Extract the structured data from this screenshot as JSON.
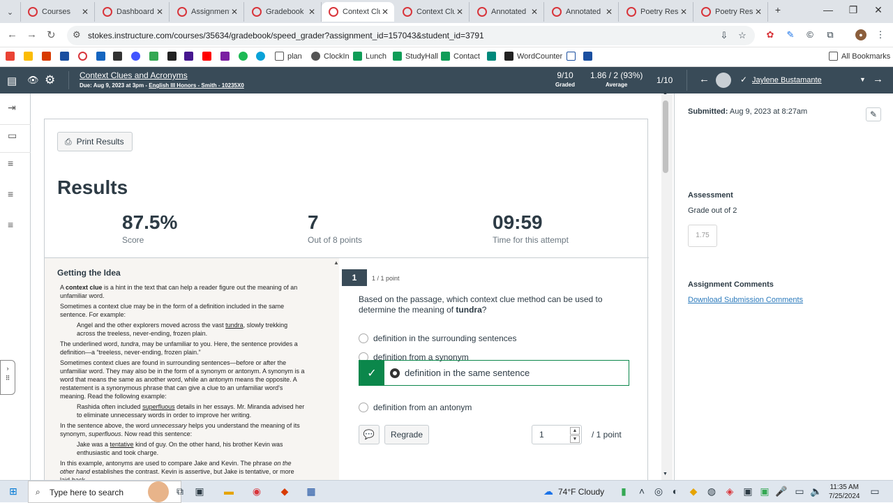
{
  "browser": {
    "tabs": [
      {
        "label": "Courses",
        "active": false
      },
      {
        "label": "Dashboard",
        "active": false
      },
      {
        "label": "Assignment",
        "active": false
      },
      {
        "label": "Gradebook",
        "active": false
      },
      {
        "label": "Context Clu",
        "active": true
      },
      {
        "label": "Context Clu",
        "active": false
      },
      {
        "label": "Annotated",
        "active": false
      },
      {
        "label": "Annotated",
        "active": false
      },
      {
        "label": "Poetry Resp",
        "active": false
      },
      {
        "label": "Poetry Resp",
        "active": false
      }
    ],
    "url": "stokes.instructure.com/courses/35634/gradebook/speed_grader?assignment_id=157043&student_id=3791",
    "bookmarks": [
      "plan",
      "ClockIn",
      "Lunch",
      "StudyHall",
      "Contact",
      "WordCounter",
      "All Bookmarks"
    ]
  },
  "header": {
    "title": "Context Clues and Acronyms",
    "due": "Due: Aug 9, 2023 at 3pm - ",
    "course": "English III Honors - Smith - 10235X0",
    "graded_value": "9/10",
    "graded_label": "Graded",
    "average_value": "1.86 / 2 (93%)",
    "average_label": "Average",
    "position": "1/10",
    "student": "Jaylene Bustamante"
  },
  "results": {
    "print_label": "Print Results",
    "title": "Results",
    "score": "87.5%",
    "score_label": "Score",
    "points": "7",
    "points_label": "Out of 8 points",
    "time": "09:59",
    "time_label": "Time for this attempt"
  },
  "passage": {
    "title": "Getting the Idea",
    "p1a": "A ",
    "p1b": "context clue",
    "p1c": " is a hint in the text that can help a reader figure out the meaning of an unfamiliar word.",
    "p2": "Sometimes a context clue may be in the form of a definition included in the same sentence. For example:",
    "p3a": "Angel and the other explorers moved across the vast ",
    "p3b": "tundra",
    "p3c": ", slowly trekking across the treeless, never-ending, frozen plain.",
    "p4a": "The underlined word, ",
    "p4b": "tundra",
    "p4c": ", may be unfamiliar to you. Here, the sentence provides a definition—a “treeless, never-ending, frozen plain.”",
    "p5": "Sometimes context clues are found in surrounding sentences—before or after the unfamiliar word. They may also be in the form of a synonym or antonym. A synonym is a word that means the same as another word, while an antonym means the opposite. A restatement is a synonymous phrase that can give a clue to an unfamiliar word's meaning. Read the following example:",
    "p6a": "Rashida often included ",
    "p6b": "superfluous",
    "p6c": " details in her essays. Mr. Miranda advised her to eliminate unnecessary words in order to improve her writing.",
    "p7a": "In the sentence above, the word ",
    "p7b": "unnecessary",
    "p7c": " helps you understand the meaning of its synonym, ",
    "p7d": "superfluous",
    "p7e": ". Now read this sentence:",
    "p8a": "Jake was a ",
    "p8b": "tentative",
    "p8c": " kind of guy. On the other hand, his brother Kevin was enthusiastic and took charge.",
    "p9a": "In this example, antonyms are used to compare Jake and Kevin. The phrase ",
    "p9b": "on the other hand",
    "p9c": " establishes the contrast. Kevin is assertive, but Jake is tentative, or more laid-back"
  },
  "question": {
    "number": "1",
    "points_text": "1 / 1 point",
    "text_a": "Based on the passage, which context clue method can be used to determine the meaning of ",
    "text_b": "tundra",
    "text_c": "?",
    "answers": [
      "definition in the surrounding sentences",
      "definition from a synonym",
      "definition in the same sentence",
      "definition from an antonym"
    ],
    "correct_index": 2,
    "regrade_label": "Regrade",
    "points_value": "1",
    "points_total": "/ 1 point"
  },
  "right_panel": {
    "submitted_label": "Submitted:",
    "submitted_value": "Aug 9, 2023 at 8:27am",
    "assessment_label": "Assessment",
    "grade_out_of": "Grade out of 2",
    "grade_placeholder": "1.75",
    "comments_label": "Assignment Comments",
    "download_link": "Download Submission Comments"
  },
  "taskbar": {
    "search_placeholder": "Type here to search",
    "weather": "74°F  Cloudy",
    "time": "11:35 AM",
    "date": "7/25/2024"
  },
  "colors": {
    "header_bg": "#394b58",
    "correct_green": "#0b874b",
    "link_blue": "#2b7abc"
  }
}
